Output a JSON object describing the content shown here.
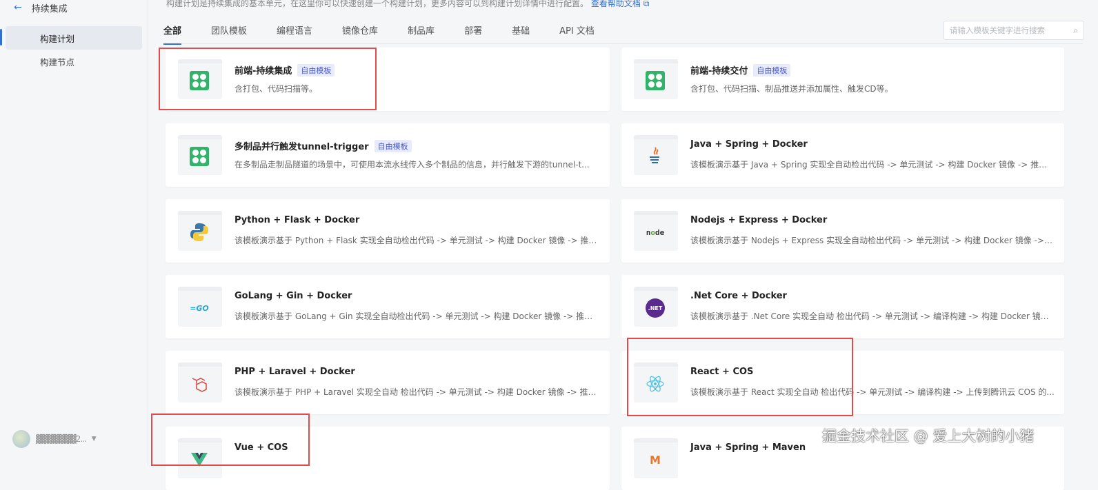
{
  "sidebar": {
    "back_label": "←",
    "title": "持续集成",
    "items": [
      {
        "label": "构建计划"
      },
      {
        "label": "构建节点"
      }
    ],
    "user_name": "▓▓▓▓▓▓▓2..."
  },
  "main": {
    "intro_text": "构建计划是持续集成的基本单元，在这里你可以快速创建一个构建计划，更多内容可以到构建计划详情中进行配置。",
    "help_link": "查看帮助文档",
    "tabs": [
      {
        "label": "全部"
      },
      {
        "label": "团队模板"
      },
      {
        "label": "编程语言"
      },
      {
        "label": "镜像仓库"
      },
      {
        "label": "制品库"
      },
      {
        "label": "部署"
      },
      {
        "label": "基础"
      },
      {
        "label": "API 文档"
      }
    ],
    "search_placeholder": "请输入模板关键字进行搜索",
    "cards": [
      {
        "title": "前端-持续集成",
        "badge": "自由模板",
        "desc": "含打包、代码扫描等。",
        "icon": "green-template-icon"
      },
      {
        "title": "前端-持续交付",
        "badge": "自由模板",
        "desc": "含打包、代码扫描、制品推送并添加属性、触发CD等。",
        "icon": "green-template-icon"
      },
      {
        "title": "多制品并行触发tunnel-trigger",
        "badge": "自由模板",
        "desc": "在多制品走制品隧道的场景中，可使用本流水线传入多个制品的信息，并行触发下游的tunnel-t...",
        "icon": "green-template-icon"
      },
      {
        "title": "Java + Spring + Docker",
        "badge": "",
        "desc": "该模板演示基于 Java + Spring 实现全自动检出代码 -> 单元测试 -> 构建 Docker 镜像 -> 推送...",
        "icon": "java-icon"
      },
      {
        "title": "Python + Flask + Docker",
        "badge": "",
        "desc": "该模板演示基于 Python + Flask 实现全自动检出代码 -> 单元测试 -> 构建 Docker 镜像 -> 推送...",
        "icon": "python-icon"
      },
      {
        "title": "Nodejs + Express + Docker",
        "badge": "",
        "desc": "该模板演示基于 Nodejs + Express 实现全自动检出代码 -> 单元测试 -> 构建 Docker 镜像 -> ...",
        "icon": "nodejs-icon"
      },
      {
        "title": "GoLang + Gin + Docker",
        "badge": "",
        "desc": "该模板演示基于 GoLang + Gin 实现全自动检出代码 -> 单元测试 -> 构建 Docker 镜像 -> 推送...",
        "icon": "go-icon"
      },
      {
        "title": ".Net Core + Docker",
        "badge": "",
        "desc": "该模板演示基于 .Net Core 实现全自动 检出代码 -> 单元测试 -> 编译构建 -> 构建 Docker 镜像...",
        "icon": "dotnet-icon"
      },
      {
        "title": "PHP + Laravel + Docker",
        "badge": "",
        "desc": "该模板演示基于 PHP + Laravel 实现全自动 检出代码 -> 单元测试 -> 构建 Docker 镜像 -> 推送...",
        "icon": "laravel-icon"
      },
      {
        "title": "React + COS",
        "badge": "",
        "desc": "该模板演示基于 React 实现全自动 检出代码 -> 单元测试 -> 编译构建 -> 上传到腾讯云 COS 的...",
        "icon": "react-icon"
      },
      {
        "title": "Vue + COS",
        "badge": "",
        "desc": "",
        "icon": "vue-icon"
      },
      {
        "title": "Java + Spring + Maven",
        "badge": "",
        "desc": "",
        "icon": "maven-icon"
      }
    ]
  },
  "watermark": "掘金技术社区 @ 爱上大树的小猪",
  "colors": {
    "accent": "#2f6fd6",
    "highlight": "#e24b4b",
    "template_green": "#31b46a"
  }
}
